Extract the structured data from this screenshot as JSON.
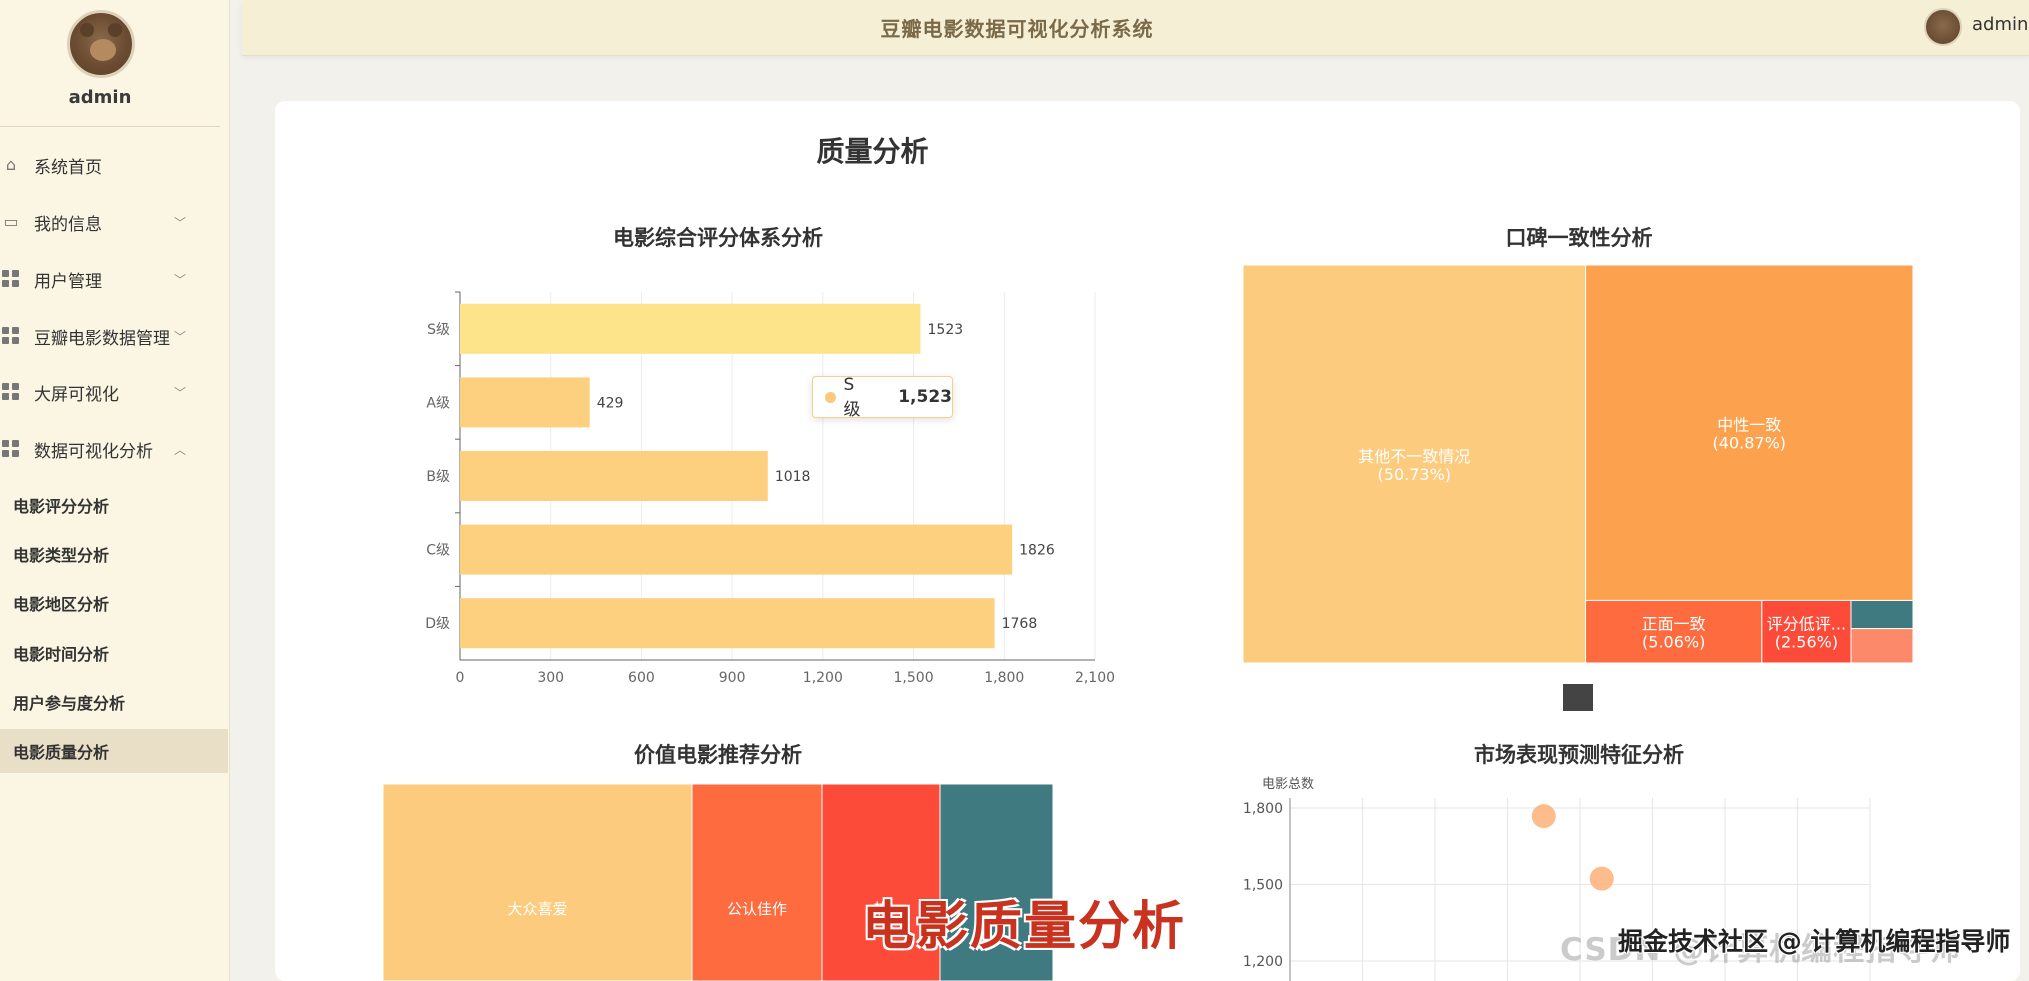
{
  "app": {
    "title": "豆瓣电影数据可视化分析系统",
    "user": "admin"
  },
  "sidebar": {
    "username": "admin",
    "items": [
      {
        "label": "系统首页",
        "icon": "home-icon",
        "chevron": false
      },
      {
        "label": "我的信息",
        "icon": "card-icon",
        "chevron": true
      },
      {
        "label": "用户管理",
        "icon": "grid-icon",
        "chevron": true
      },
      {
        "label": "豆瓣电影数据管理",
        "icon": "grid-icon",
        "chevron": true
      },
      {
        "label": "大屏可视化",
        "icon": "grid-icon",
        "chevron": true
      },
      {
        "label": "数据可视化分析",
        "icon": "grid-icon",
        "chevron": true,
        "expanded": true
      }
    ],
    "subitems": [
      {
        "label": "电影评分分析"
      },
      {
        "label": "电影类型分析"
      },
      {
        "label": "电影地区分析"
      },
      {
        "label": "电影时间分析"
      },
      {
        "label": "用户参与度分析"
      },
      {
        "label": "电影质量分析",
        "active": true
      }
    ]
  },
  "page": {
    "title": "质量分析"
  },
  "charts": {
    "rating_title": "电影综合评分体系分析",
    "wom_title": "口碑一致性分析",
    "value_title": "价值电影推荐分析",
    "market_title": "市场表现预测特征分析"
  },
  "tooltip": {
    "label": "S级",
    "value": "1,523"
  },
  "chart_data": [
    {
      "type": "bar",
      "orientation": "horizontal",
      "title": "电影综合评分体系分析",
      "categories": [
        "S级",
        "A级",
        "B级",
        "C级",
        "D级"
      ],
      "values": [
        1523,
        429,
        1018,
        1826,
        1768
      ],
      "xlim": [
        0,
        2100
      ],
      "xticks": [
        "0",
        "300",
        "600",
        "900",
        "1,200",
        "1,500",
        "1,800",
        "2,100"
      ],
      "color": "#fdd07f"
    },
    {
      "type": "treemap",
      "title": "口碑一致性分析",
      "items": [
        {
          "name": "其他不一致情况",
          "percent": "(50.73%)",
          "value": 50.73,
          "color": "#fdcb7e"
        },
        {
          "name": "中性一致",
          "percent": "(40.87%)",
          "value": 40.87,
          "color": "#fca24e"
        },
        {
          "name": "正面一致",
          "percent": "(5.06%)",
          "value": 5.06,
          "color": "#fd6b3f"
        },
        {
          "name": "评分低评...",
          "percent": "(2.56%)",
          "value": 2.56,
          "color": "#fc4b39"
        }
      ]
    },
    {
      "type": "treemap",
      "title": "价值电影推荐分析",
      "items": [
        {
          "name": "大众喜爱",
          "color": "#fdcb7e"
        },
        {
          "name": "公认佳作",
          "color": "#fd6b3f"
        },
        {
          "name": "热",
          "color": "#fc4b39"
        },
        {
          "name": "",
          "color": "#3e7a7f"
        }
      ]
    },
    {
      "type": "scatter",
      "title": "市场表现预测特征分析",
      "ylabel": "电影总数",
      "yticks": [
        "1,800",
        "1,500",
        "1,200"
      ],
      "ylim": [
        1050,
        1850
      ],
      "points": [
        {
          "x": 3.5,
          "y": 1768
        },
        {
          "x": 4.3,
          "y": 1523
        }
      ],
      "color": "#fdb077"
    }
  ],
  "overlay": {
    "caption": "电影质量分析",
    "watermark_back": "CSDN @计算机编程指导师",
    "watermark_front": "掘金技术社区 @ 计算机编程指导师"
  }
}
